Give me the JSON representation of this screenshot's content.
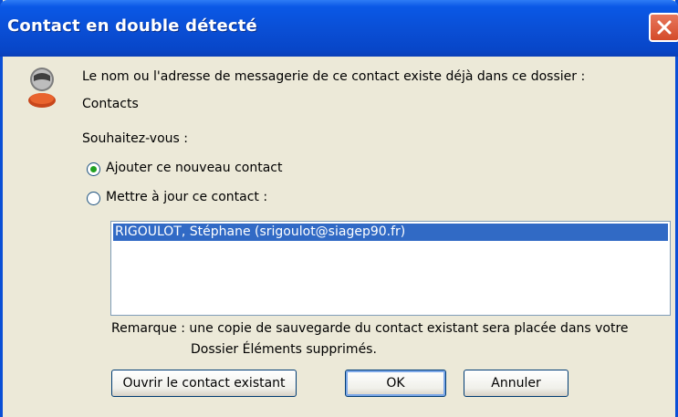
{
  "window": {
    "title": "Contact en double détecté"
  },
  "message": {
    "line1": "Le nom ou l'adresse de messagerie de ce contact existe déjà dans ce dossier :",
    "folder": "Contacts",
    "question": "Souhaitez-vous :"
  },
  "options": [
    {
      "label": "Ajouter ce nouveau contact",
      "selected": true
    },
    {
      "label": "Mettre à jour ce contact :",
      "selected": false
    }
  ],
  "contacts_list": {
    "items": [
      "RIGOULOT, Stéphane (srigoulot@siagep90.fr)"
    ],
    "selected_index": 0
  },
  "note": {
    "line1": "Remarque : une copie de sauvegarde du contact existant sera placée dans votre",
    "line2": "Dossier Éléments supprimés."
  },
  "buttons": {
    "open_existing": "Ouvrir le contact existant",
    "ok": "OK",
    "cancel": "Annuler"
  },
  "icons": [
    "close-icon",
    "contact-person-icon"
  ],
  "colors": {
    "titlebar": "#0a4fd6",
    "selection": "#316ac5",
    "dialog_bg": "#ece9d8"
  }
}
